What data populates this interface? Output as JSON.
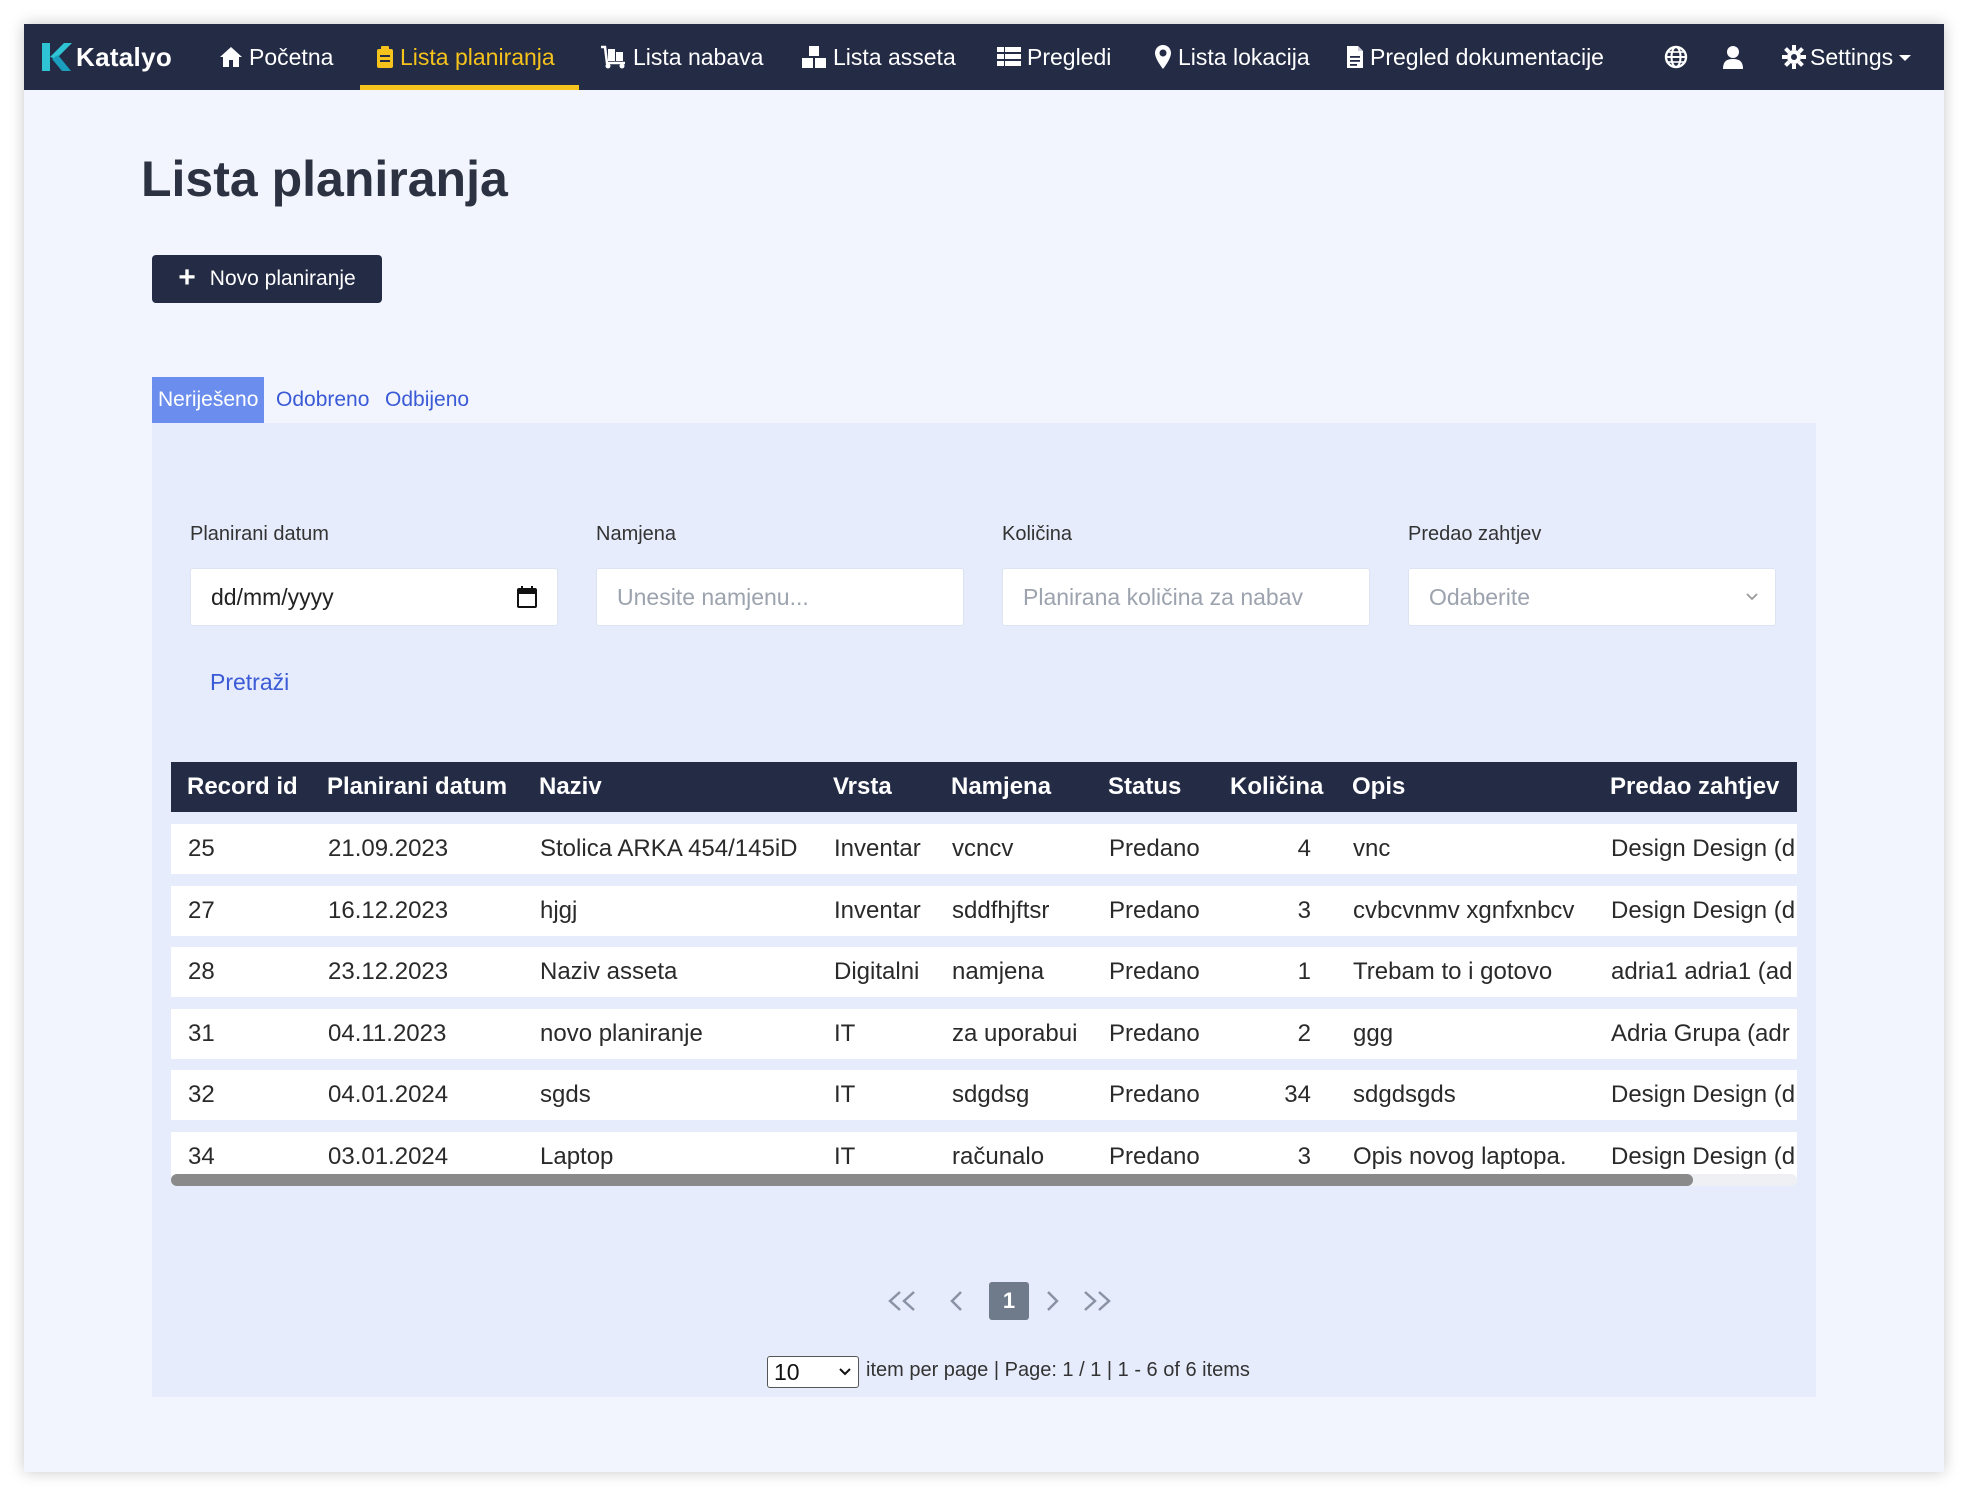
{
  "brand": {
    "name": "Katalyo"
  },
  "nav": {
    "items": [
      {
        "label": "Početna",
        "icon": "home-icon"
      },
      {
        "label": "Lista planiranja",
        "icon": "clipboard-icon",
        "active": true
      },
      {
        "label": "Lista nabava",
        "icon": "dolly-icon"
      },
      {
        "label": "Lista asseta",
        "icon": "boxes-icon"
      },
      {
        "label": "Pregledi",
        "icon": "table-icon"
      },
      {
        "label": "Lista lokacija",
        "icon": "map-marker-icon"
      },
      {
        "label": "Pregled dokumentacije",
        "icon": "document-icon"
      }
    ],
    "settings_label": "Settings",
    "active_color": "#f6c21c",
    "bg_color": "#232b45"
  },
  "page": {
    "title": "Lista planiranja",
    "new_button_label": "Novo planiranje"
  },
  "tabs": [
    {
      "label": "Neriješeno",
      "active": true
    },
    {
      "label": "Odobreno"
    },
    {
      "label": "Odbijeno"
    }
  ],
  "filters": {
    "date_label": "Planirani datum",
    "date_value": "dd/mm/yyyy",
    "purpose_label": "Namjena",
    "purpose_placeholder": "Unesite namjenu...",
    "quantity_label": "Količina",
    "quantity_placeholder": "Planirana količina za nabav",
    "requester_label": "Predao zahtjev",
    "requester_placeholder": "Odaberite",
    "search_label": "Pretraži"
  },
  "table": {
    "columns": [
      "Record id",
      "Planirani datum",
      "Naziv",
      "Vrsta",
      "Namjena",
      "Status",
      "Količina",
      "Opis",
      "Predao zahtjev"
    ],
    "rows": [
      [
        "25",
        "21.09.2023",
        "Stolica ARKA 454/145iD",
        "Inventar",
        "vcncv",
        "Predano",
        "4",
        "vnc",
        "Design Design (d"
      ],
      [
        "27",
        "16.12.2023",
        "hjgj",
        "Inventar",
        "sddfhjftsr",
        "Predano",
        "3",
        "cvbcvnmv xgnfxnbcv",
        "Design Design (d"
      ],
      [
        "28",
        "23.12.2023",
        "Naziv asseta",
        "Digitalni",
        "namjena",
        "Predano",
        "1",
        "Trebam to i gotovo",
        "adria1 adria1 (ad"
      ],
      [
        "31",
        "04.11.2023",
        "novo planiranje",
        "IT",
        "za uporabui",
        "Predano",
        "2",
        "ggg",
        "Adria Grupa (adr"
      ],
      [
        "32",
        "04.01.2024",
        "sgds",
        "IT",
        "sdgdsg",
        "Predano",
        "34",
        "sdgdsgds",
        "Design Design (d"
      ],
      [
        "34",
        "03.01.2024",
        "Laptop",
        "IT",
        "računalo",
        "Predano",
        "3",
        "Opis novog laptopa.",
        "Design Design (d"
      ]
    ]
  },
  "pagination": {
    "current_page": "1",
    "per_page": "10",
    "info": "item per page | Page: 1 / 1 | 1 - 6 of 6 items"
  }
}
